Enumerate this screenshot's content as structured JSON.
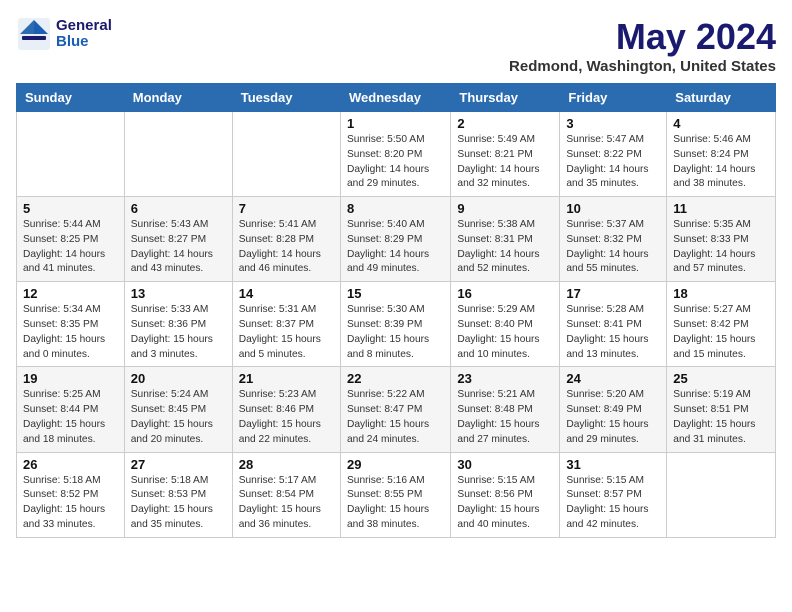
{
  "header": {
    "logo_line1": "General",
    "logo_line2": "Blue",
    "month_title": "May 2024",
    "subtitle": "Redmond, Washington, United States"
  },
  "days_of_week": [
    "Sunday",
    "Monday",
    "Tuesday",
    "Wednesday",
    "Thursday",
    "Friday",
    "Saturday"
  ],
  "weeks": [
    [
      {
        "day": "",
        "text": ""
      },
      {
        "day": "",
        "text": ""
      },
      {
        "day": "",
        "text": ""
      },
      {
        "day": "1",
        "text": "Sunrise: 5:50 AM\nSunset: 8:20 PM\nDaylight: 14 hours\nand 29 minutes."
      },
      {
        "day": "2",
        "text": "Sunrise: 5:49 AM\nSunset: 8:21 PM\nDaylight: 14 hours\nand 32 minutes."
      },
      {
        "day": "3",
        "text": "Sunrise: 5:47 AM\nSunset: 8:22 PM\nDaylight: 14 hours\nand 35 minutes."
      },
      {
        "day": "4",
        "text": "Sunrise: 5:46 AM\nSunset: 8:24 PM\nDaylight: 14 hours\nand 38 minutes."
      }
    ],
    [
      {
        "day": "5",
        "text": "Sunrise: 5:44 AM\nSunset: 8:25 PM\nDaylight: 14 hours\nand 41 minutes."
      },
      {
        "day": "6",
        "text": "Sunrise: 5:43 AM\nSunset: 8:27 PM\nDaylight: 14 hours\nand 43 minutes."
      },
      {
        "day": "7",
        "text": "Sunrise: 5:41 AM\nSunset: 8:28 PM\nDaylight: 14 hours\nand 46 minutes."
      },
      {
        "day": "8",
        "text": "Sunrise: 5:40 AM\nSunset: 8:29 PM\nDaylight: 14 hours\nand 49 minutes."
      },
      {
        "day": "9",
        "text": "Sunrise: 5:38 AM\nSunset: 8:31 PM\nDaylight: 14 hours\nand 52 minutes."
      },
      {
        "day": "10",
        "text": "Sunrise: 5:37 AM\nSunset: 8:32 PM\nDaylight: 14 hours\nand 55 minutes."
      },
      {
        "day": "11",
        "text": "Sunrise: 5:35 AM\nSunset: 8:33 PM\nDaylight: 14 hours\nand 57 minutes."
      }
    ],
    [
      {
        "day": "12",
        "text": "Sunrise: 5:34 AM\nSunset: 8:35 PM\nDaylight: 15 hours\nand 0 minutes."
      },
      {
        "day": "13",
        "text": "Sunrise: 5:33 AM\nSunset: 8:36 PM\nDaylight: 15 hours\nand 3 minutes."
      },
      {
        "day": "14",
        "text": "Sunrise: 5:31 AM\nSunset: 8:37 PM\nDaylight: 15 hours\nand 5 minutes."
      },
      {
        "day": "15",
        "text": "Sunrise: 5:30 AM\nSunset: 8:39 PM\nDaylight: 15 hours\nand 8 minutes."
      },
      {
        "day": "16",
        "text": "Sunrise: 5:29 AM\nSunset: 8:40 PM\nDaylight: 15 hours\nand 10 minutes."
      },
      {
        "day": "17",
        "text": "Sunrise: 5:28 AM\nSunset: 8:41 PM\nDaylight: 15 hours\nand 13 minutes."
      },
      {
        "day": "18",
        "text": "Sunrise: 5:27 AM\nSunset: 8:42 PM\nDaylight: 15 hours\nand 15 minutes."
      }
    ],
    [
      {
        "day": "19",
        "text": "Sunrise: 5:25 AM\nSunset: 8:44 PM\nDaylight: 15 hours\nand 18 minutes."
      },
      {
        "day": "20",
        "text": "Sunrise: 5:24 AM\nSunset: 8:45 PM\nDaylight: 15 hours\nand 20 minutes."
      },
      {
        "day": "21",
        "text": "Sunrise: 5:23 AM\nSunset: 8:46 PM\nDaylight: 15 hours\nand 22 minutes."
      },
      {
        "day": "22",
        "text": "Sunrise: 5:22 AM\nSunset: 8:47 PM\nDaylight: 15 hours\nand 24 minutes."
      },
      {
        "day": "23",
        "text": "Sunrise: 5:21 AM\nSunset: 8:48 PM\nDaylight: 15 hours\nand 27 minutes."
      },
      {
        "day": "24",
        "text": "Sunrise: 5:20 AM\nSunset: 8:49 PM\nDaylight: 15 hours\nand 29 minutes."
      },
      {
        "day": "25",
        "text": "Sunrise: 5:19 AM\nSunset: 8:51 PM\nDaylight: 15 hours\nand 31 minutes."
      }
    ],
    [
      {
        "day": "26",
        "text": "Sunrise: 5:18 AM\nSunset: 8:52 PM\nDaylight: 15 hours\nand 33 minutes."
      },
      {
        "day": "27",
        "text": "Sunrise: 5:18 AM\nSunset: 8:53 PM\nDaylight: 15 hours\nand 35 minutes."
      },
      {
        "day": "28",
        "text": "Sunrise: 5:17 AM\nSunset: 8:54 PM\nDaylight: 15 hours\nand 36 minutes."
      },
      {
        "day": "29",
        "text": "Sunrise: 5:16 AM\nSunset: 8:55 PM\nDaylight: 15 hours\nand 38 minutes."
      },
      {
        "day": "30",
        "text": "Sunrise: 5:15 AM\nSunset: 8:56 PM\nDaylight: 15 hours\nand 40 minutes."
      },
      {
        "day": "31",
        "text": "Sunrise: 5:15 AM\nSunset: 8:57 PM\nDaylight: 15 hours\nand 42 minutes."
      },
      {
        "day": "",
        "text": ""
      }
    ]
  ]
}
